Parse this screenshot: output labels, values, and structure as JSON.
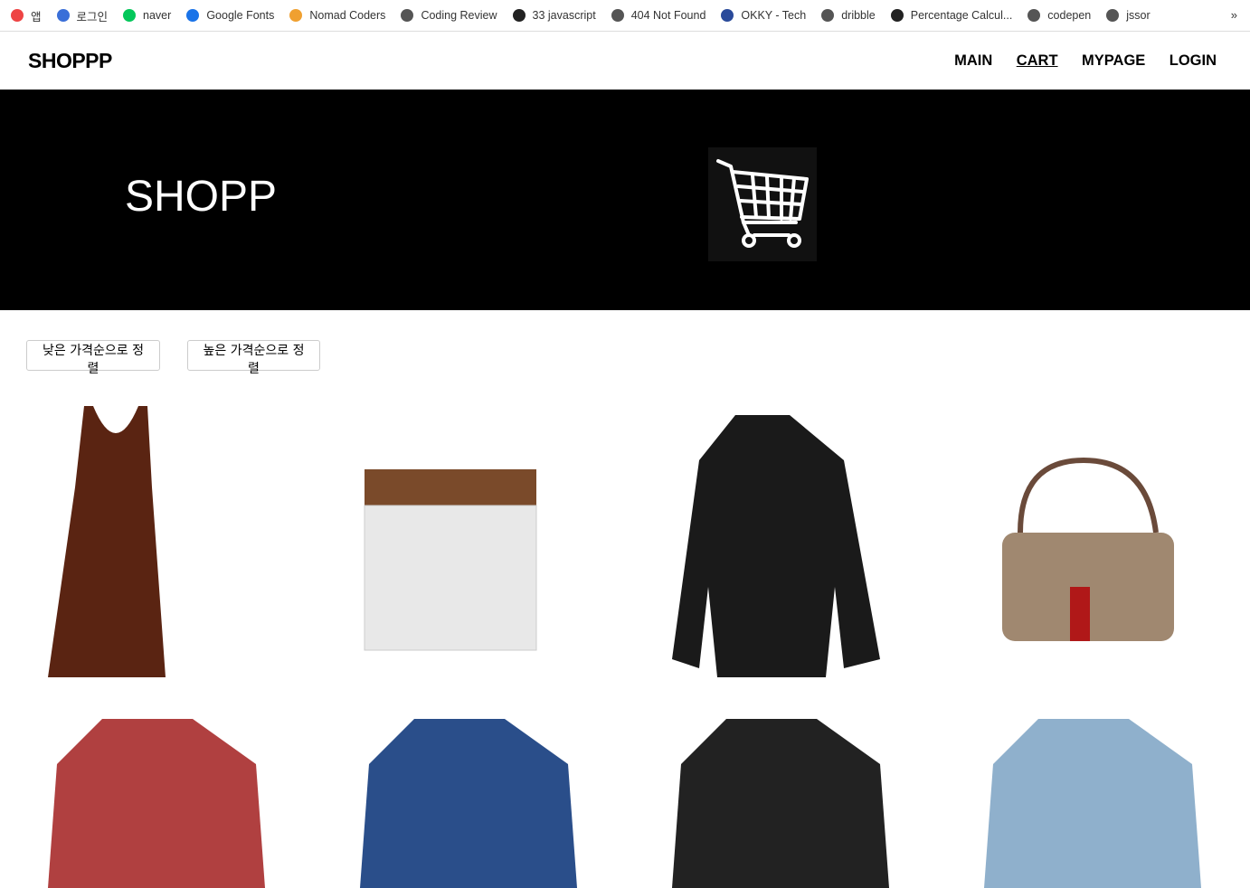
{
  "bookmarks": [
    {
      "label": "앱",
      "icon": "apps-grid-icon",
      "color": "#e44"
    },
    {
      "label": "로그인",
      "icon": "c-logo-icon",
      "color": "#3a6fd8"
    },
    {
      "label": "naver",
      "icon": "naver-icon",
      "color": "#03c75a"
    },
    {
      "label": "Google Fonts",
      "icon": "google-fonts-icon",
      "color": "#1a73e8"
    },
    {
      "label": "Nomad Coders",
      "icon": "nomad-icon",
      "color": "#f0a030"
    },
    {
      "label": "Coding Review",
      "icon": "globe-icon",
      "color": "#555"
    },
    {
      "label": "33 javascript",
      "icon": "github-icon",
      "color": "#222"
    },
    {
      "label": "404 Not Found",
      "icon": "globe-icon",
      "color": "#555"
    },
    {
      "label": "OKKY - Tech",
      "icon": "okky-icon",
      "color": "#2a4a9a"
    },
    {
      "label": "dribble",
      "icon": "globe-icon",
      "color": "#555"
    },
    {
      "label": "Percentage Calcul...",
      "icon": "percent-icon",
      "color": "#222"
    },
    {
      "label": "codepen",
      "icon": "globe-icon",
      "color": "#555"
    },
    {
      "label": "jssor",
      "icon": "globe-icon",
      "color": "#555"
    }
  ],
  "bookmarks_more": "»",
  "header": {
    "logo": "SHOPPP",
    "nav": [
      "MAIN",
      "CART",
      "MYPAGE",
      "LOGIN"
    ]
  },
  "hero": {
    "title": "SHOPP"
  },
  "sort": {
    "low": "낮은 가격순으로 정렬",
    "high": "높은 가격순으로 정렬"
  },
  "products": [
    {
      "name": "brown tank dress",
      "color": "#5a2412"
    },
    {
      "name": "woven clutch",
      "color": "#e8e8e8"
    },
    {
      "name": "black puffer jacket",
      "color": "#1a1a1a"
    },
    {
      "name": "gg shoulder bag",
      "color": "#a08870"
    },
    {
      "name": "plaid jacket red",
      "color": "#b04040"
    },
    {
      "name": "plaid hooded shirt blue",
      "color": "#2a4e8a"
    },
    {
      "name": "sheer black top",
      "color": "#222"
    },
    {
      "name": "blue jeans",
      "color": "#8fb0cc"
    }
  ]
}
